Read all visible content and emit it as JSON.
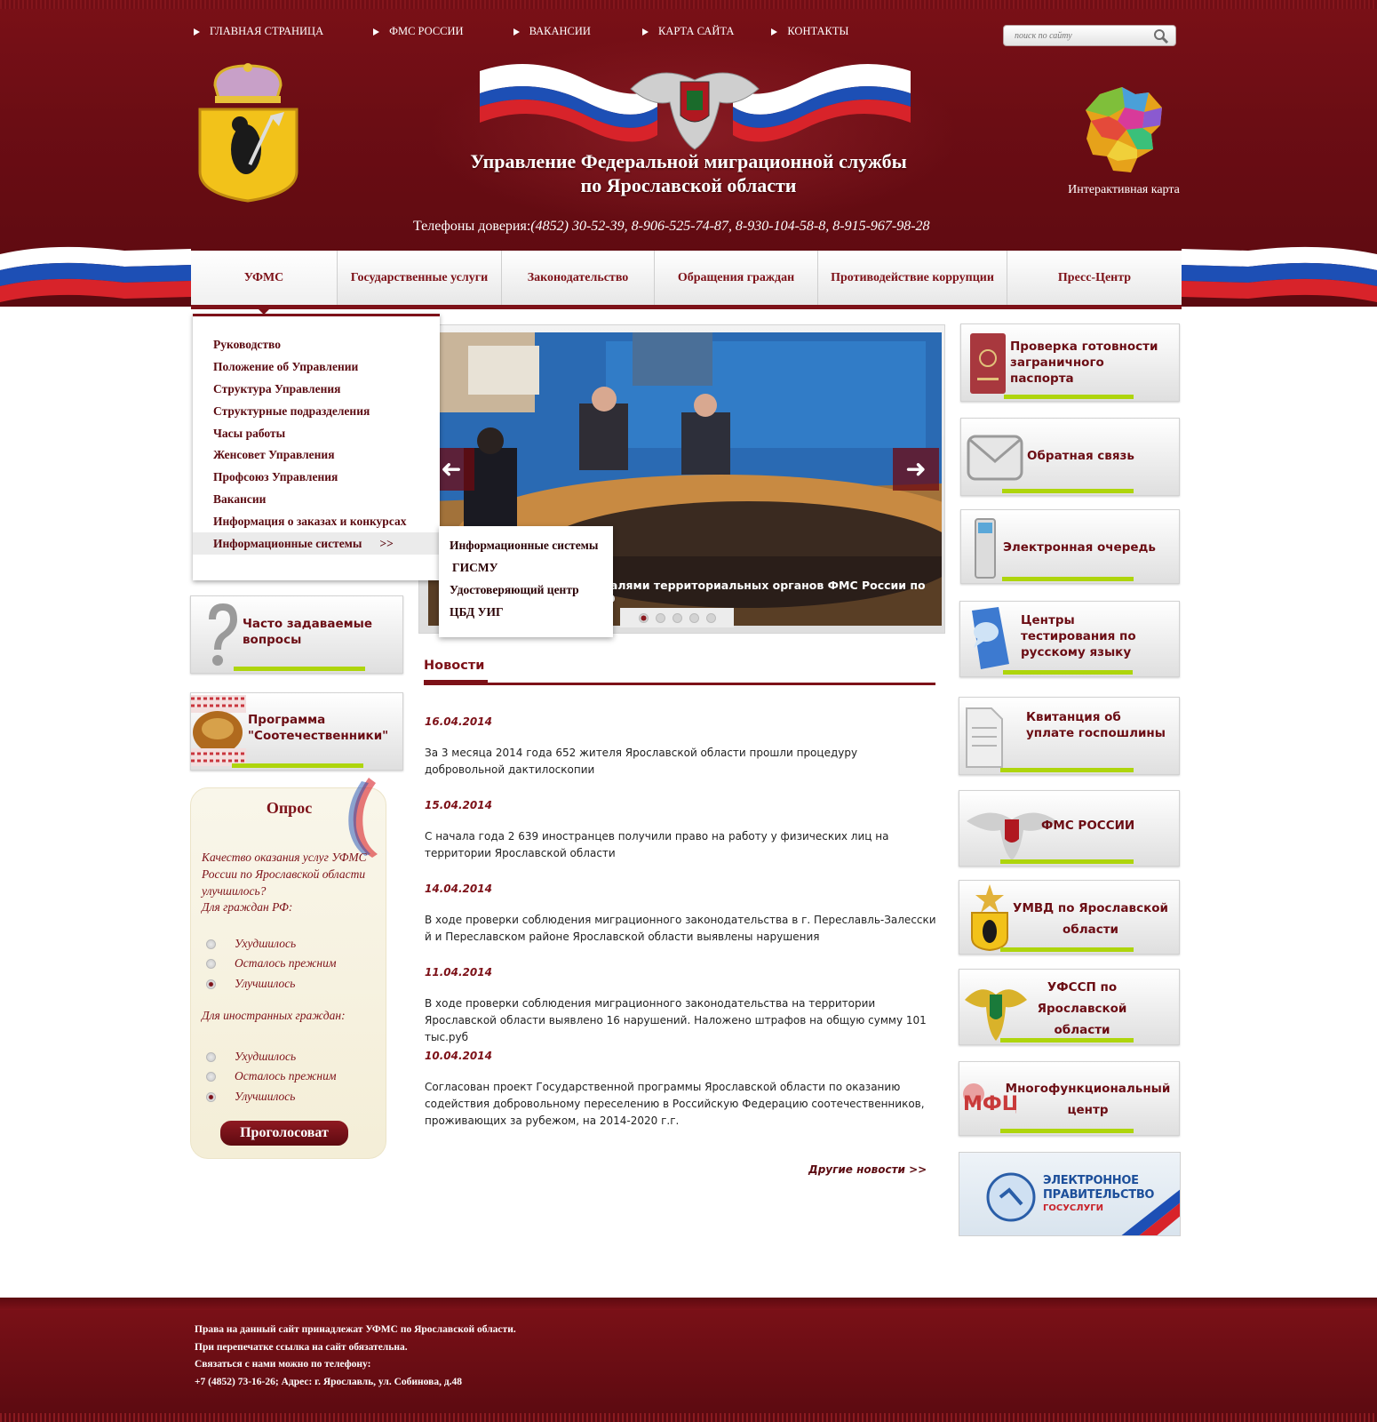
{
  "top_nav": [
    {
      "label": "ГЛАВНАЯ СТРАНИЦА"
    },
    {
      "label": "ФМС РОССИИ"
    },
    {
      "label": "ВАКАНСИИ"
    },
    {
      "label": "КАРТА САЙТА"
    },
    {
      "label": "КОНТАКТЫ"
    }
  ],
  "search": {
    "placeholder": "поиск по сайту",
    "icon": "search-icon"
  },
  "header": {
    "title_line1": "Управление Федеральной миграционной службы",
    "title_line2": "по Ярославской области",
    "phones_label": "Телефоны доверия:",
    "phones": "(4852) 30-52-39,  8-906-525-74-87,  8-930-104-58-8,  8-915-967-98-28",
    "map_label": "Интерактивная карта",
    "colors": {
      "primary": "#7d1118",
      "accent_green": "#aed50c"
    }
  },
  "main_nav": [
    {
      "label": "УФМС",
      "active": true
    },
    {
      "label": "Государственные услуги"
    },
    {
      "label": "Законодательство"
    },
    {
      "label": "Обращения граждан"
    },
    {
      "label": "Противодействие коррупции"
    },
    {
      "label": "Пресс-Центр"
    }
  ],
  "dropdown": {
    "items": [
      {
        "label": "Руководство"
      },
      {
        "label": "Положение об Управлении"
      },
      {
        "label": "Структура Управления"
      },
      {
        "label": "Структурные подразделения"
      },
      {
        "label": "Часы работы"
      },
      {
        "label": "Женсовет Управления"
      },
      {
        "label": "Профсоюз Управления"
      },
      {
        "label": "Вакансии"
      },
      {
        "label": "Информация о заказах и конкурсах"
      },
      {
        "label": "Информационные системы",
        "arrow": ">>"
      }
    ],
    "submenu": [
      {
        "label": "Информационные системы"
      },
      {
        "label": "ГИСМУ"
      },
      {
        "label": "Удостоверяющий центр"
      },
      {
        "label": "ЦБД УИГ"
      }
    ]
  },
  "slider": {
    "caption": "...угалями территориальных органов ФМС России по ЦФО",
    "dots": 5,
    "active_dot": 1
  },
  "news": {
    "title": "Новости",
    "items": [
      {
        "date": "16.04.2014",
        "text": "За 3 месяца 2014 года 652 жителя Ярославской области прошли процедуру добровольной дактилоскопии"
      },
      {
        "date": "15.04.2014",
        "text": "С начала года 2 639 иностранцев получили право на работу у физических лиц на территории Ярославской области"
      },
      {
        "date": "14.04.2014",
        "text": "В ходе проверки соблюдения миграционного законодательства в г. Переславль-Залесский и Переславском районе Ярославской области выявлены нарушения"
      },
      {
        "date": "11.04.2014",
        "text": "В ходе проверки соблюдения миграционного законодательства на территории Ярославской области выявлено 16 нарушений. Наложено штрафов на общую сумму 101 тыс.руб"
      },
      {
        "date": "10.04.2014",
        "text": "Согласован проект Государственной программы Ярославской области по оказанию содействия добровольному переселению в Российскую Федерацию соотечественников, проживающих за рубежом, на 2014-2020 г.г."
      }
    ],
    "more": "Другие новости >>"
  },
  "left_banners": [
    {
      "label": "Часто задаваемые вопросы"
    },
    {
      "label": "Программа \"Соотечественники\""
    }
  ],
  "poll": {
    "title": "Опрос",
    "question": "Качество оказания услуг УФМС России по Ярославской области улучшилось?",
    "group1": "Для граждан РФ:",
    "group2": "Для иностранных граждан:",
    "options": [
      "Ухудшилось",
      "Осталось прежним",
      "Улучшилось"
    ],
    "selected": "Улучшилось",
    "button": "Проголосоват"
  },
  "right_banners": [
    {
      "label": "Проверка готовности заграничного паспорта"
    },
    {
      "label": "Обратная связь"
    },
    {
      "label": "Электронная очередь"
    },
    {
      "label": "Центры тестирования по русскому языку"
    },
    {
      "label": "Квитанция об уплате госпошлины"
    },
    {
      "label": "ФМС РОССИИ"
    },
    {
      "label": "УМВД по Ярославской области"
    },
    {
      "label": "УФССП по Ярославской области"
    },
    {
      "label": "Многофункциональный центр"
    }
  ],
  "egov": {
    "line1": "ЭЛЕКТРОННОЕ",
    "line2": "ПРАВИТЕЛЬСТВО",
    "line3": "ГОСУСЛУГИ"
  },
  "footer": {
    "lines": [
      "Права на данный сайт принадлежат УФМС по Ярославской области.",
      "При перепечатке ссылка на сайт обязательна.",
      "Связаться с нами можно по телефону:",
      "+7 (4852) 73-16-26; Адрес: г. Ярославль, ул. Собинова, д.48"
    ]
  }
}
